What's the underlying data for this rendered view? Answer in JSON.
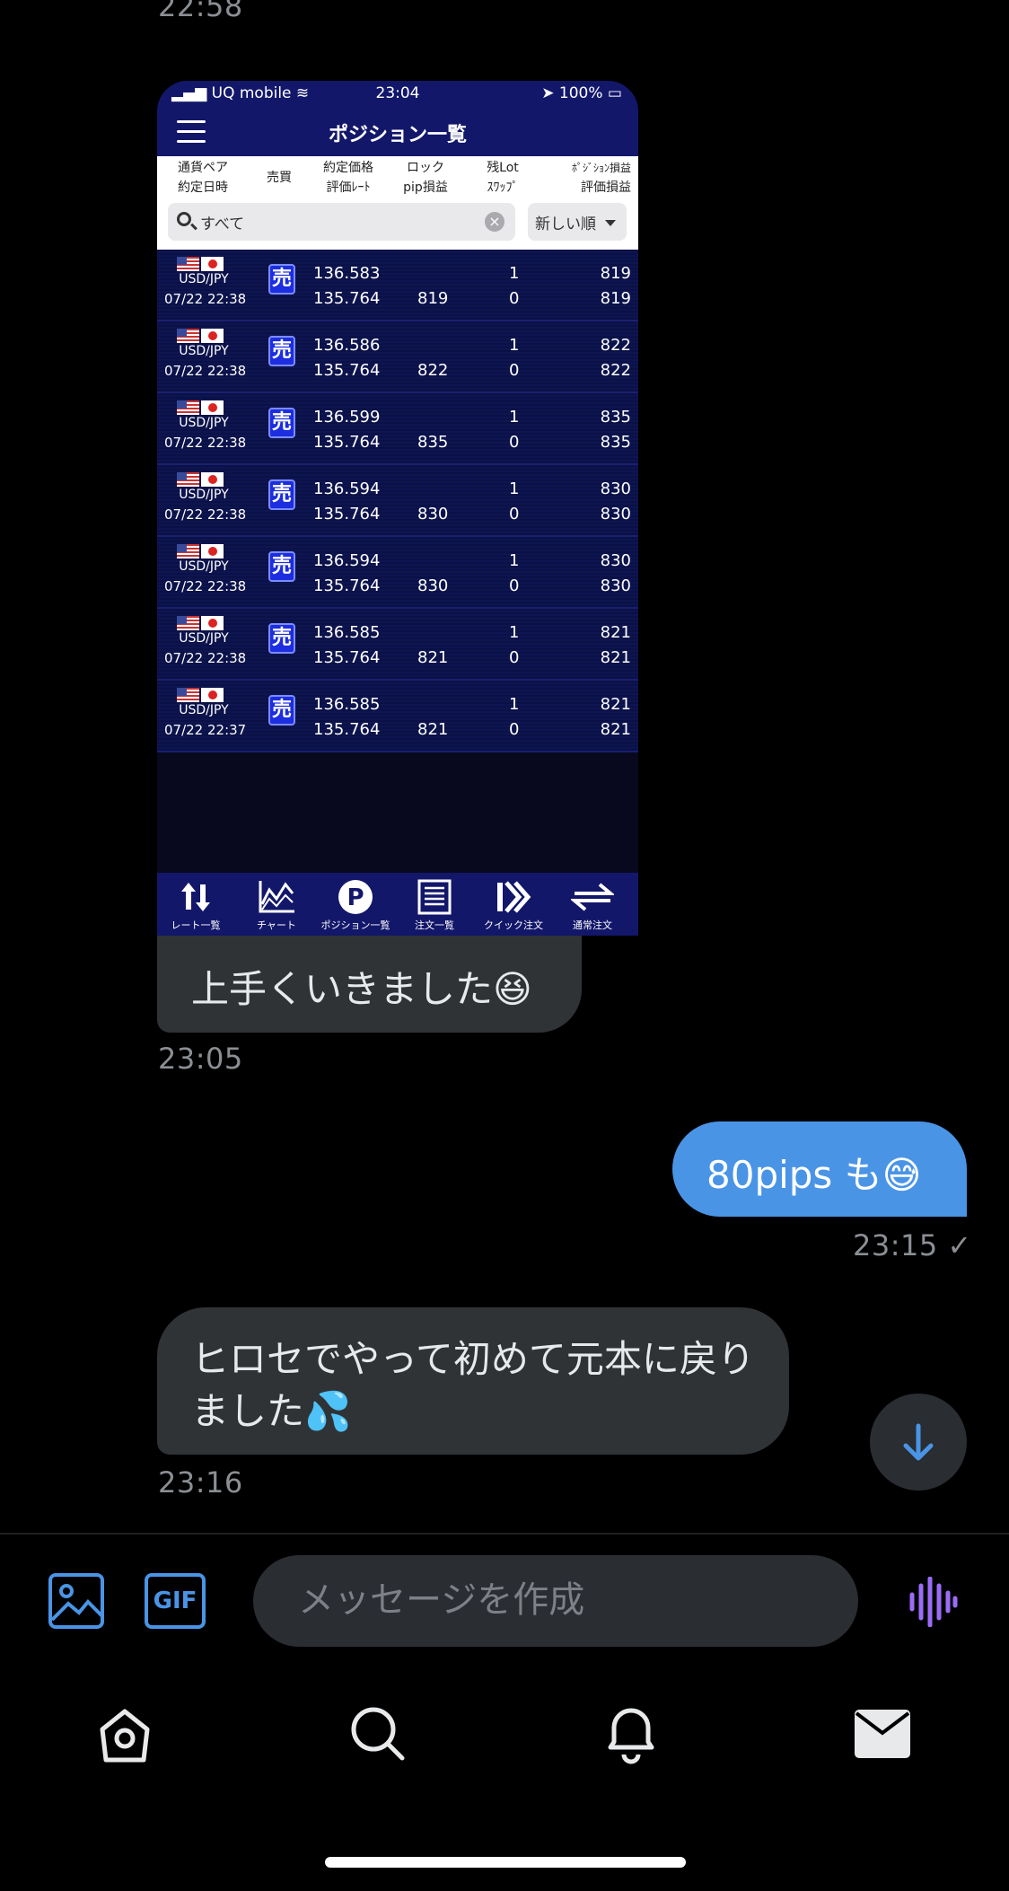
{
  "top_timestamp": "22:58",
  "shot": {
    "status": {
      "carrier": "UQ mobile",
      "time": "23:04",
      "battery": "100%"
    },
    "title": "ポジション一覧",
    "headers": {
      "col1": [
        "通貨ペア",
        "約定日時"
      ],
      "col2": [
        "売買"
      ],
      "col3": [
        "約定価格",
        "評価ﾚｰﾄ"
      ],
      "col4": [
        "ロック",
        "pip損益"
      ],
      "col5": [
        "残Lot",
        "ｽﾜｯﾌﾟ"
      ],
      "col6": [
        "ﾎﾟｼﾞｼｮﾝ損益",
        "評価損益"
      ]
    },
    "search_placeholder": "すべて",
    "sort_label": "新しい順",
    "rows": [
      {
        "pair": "USD/JPY",
        "date": "07/22 22:38",
        "side": "売",
        "price": "136.583",
        "rate": "135.764",
        "pip": "819",
        "lot": "1",
        "swap": "0",
        "pos": "819",
        "eval": "819"
      },
      {
        "pair": "USD/JPY",
        "date": "07/22 22:38",
        "side": "売",
        "price": "136.586",
        "rate": "135.764",
        "pip": "822",
        "lot": "1",
        "swap": "0",
        "pos": "822",
        "eval": "822"
      },
      {
        "pair": "USD/JPY",
        "date": "07/22 22:38",
        "side": "売",
        "price": "136.599",
        "rate": "135.764",
        "pip": "835",
        "lot": "1",
        "swap": "0",
        "pos": "835",
        "eval": "835"
      },
      {
        "pair": "USD/JPY",
        "date": "07/22 22:38",
        "side": "売",
        "price": "136.594",
        "rate": "135.764",
        "pip": "830",
        "lot": "1",
        "swap": "0",
        "pos": "830",
        "eval": "830"
      },
      {
        "pair": "USD/JPY",
        "date": "07/22 22:38",
        "side": "売",
        "price": "136.594",
        "rate": "135.764",
        "pip": "830",
        "lot": "1",
        "swap": "0",
        "pos": "830",
        "eval": "830"
      },
      {
        "pair": "USD/JPY",
        "date": "07/22 22:38",
        "side": "売",
        "price": "136.585",
        "rate": "135.764",
        "pip": "821",
        "lot": "1",
        "swap": "0",
        "pos": "821",
        "eval": "821"
      },
      {
        "pair": "USD/JPY",
        "date": "07/22 22:37",
        "side": "売",
        "price": "136.585",
        "rate": "135.764",
        "pip": "821",
        "lot": "1",
        "swap": "0",
        "pos": "821",
        "eval": "821"
      }
    ],
    "tabs": [
      "レート一覧",
      "チャート",
      "ポジション一覧",
      "注文一覧",
      "クイック注文",
      "通常注文"
    ]
  },
  "messages": [
    {
      "text": "上手くいきました😆",
      "time": "23:05"
    },
    {
      "text": "80pips も😅",
      "time": "23:15",
      "check": "✓"
    },
    {
      "line1": "ヒロセでやって初めて元本に戻り",
      "line2": "ました💦",
      "time": "23:16"
    }
  ],
  "composer": {
    "placeholder": "メッセージを作成",
    "gif_label": "GIF"
  },
  "colors": {
    "accent": "#4a94e6",
    "bubble_in": "#2f3336",
    "voice": "#9b6cf5"
  }
}
